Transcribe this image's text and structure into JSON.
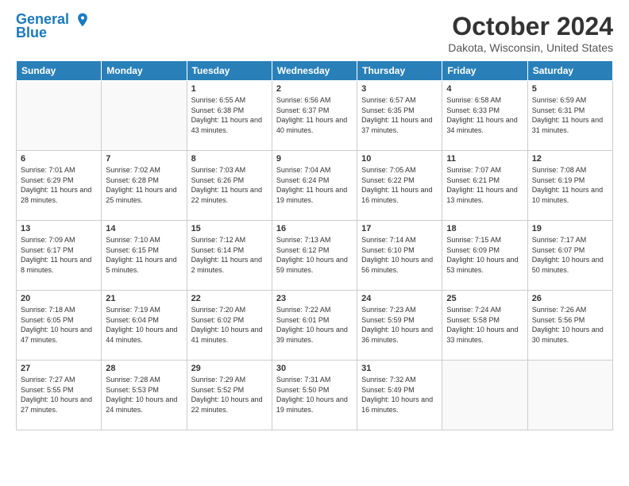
{
  "header": {
    "logo_line1": "General",
    "logo_line2": "Blue",
    "month": "October 2024",
    "location": "Dakota, Wisconsin, United States"
  },
  "days_of_week": [
    "Sunday",
    "Monday",
    "Tuesday",
    "Wednesday",
    "Thursday",
    "Friday",
    "Saturday"
  ],
  "weeks": [
    [
      {
        "day": "",
        "content": ""
      },
      {
        "day": "",
        "content": ""
      },
      {
        "day": "1",
        "content": "Sunrise: 6:55 AM\nSunset: 6:38 PM\nDaylight: 11 hours\nand 43 minutes."
      },
      {
        "day": "2",
        "content": "Sunrise: 6:56 AM\nSunset: 6:37 PM\nDaylight: 11 hours\nand 40 minutes."
      },
      {
        "day": "3",
        "content": "Sunrise: 6:57 AM\nSunset: 6:35 PM\nDaylight: 11 hours\nand 37 minutes."
      },
      {
        "day": "4",
        "content": "Sunrise: 6:58 AM\nSunset: 6:33 PM\nDaylight: 11 hours\nand 34 minutes."
      },
      {
        "day": "5",
        "content": "Sunrise: 6:59 AM\nSunset: 6:31 PM\nDaylight: 11 hours\nand 31 minutes."
      }
    ],
    [
      {
        "day": "6",
        "content": "Sunrise: 7:01 AM\nSunset: 6:29 PM\nDaylight: 11 hours\nand 28 minutes."
      },
      {
        "day": "7",
        "content": "Sunrise: 7:02 AM\nSunset: 6:28 PM\nDaylight: 11 hours\nand 25 minutes."
      },
      {
        "day": "8",
        "content": "Sunrise: 7:03 AM\nSunset: 6:26 PM\nDaylight: 11 hours\nand 22 minutes."
      },
      {
        "day": "9",
        "content": "Sunrise: 7:04 AM\nSunset: 6:24 PM\nDaylight: 11 hours\nand 19 minutes."
      },
      {
        "day": "10",
        "content": "Sunrise: 7:05 AM\nSunset: 6:22 PM\nDaylight: 11 hours\nand 16 minutes."
      },
      {
        "day": "11",
        "content": "Sunrise: 7:07 AM\nSunset: 6:21 PM\nDaylight: 11 hours\nand 13 minutes."
      },
      {
        "day": "12",
        "content": "Sunrise: 7:08 AM\nSunset: 6:19 PM\nDaylight: 11 hours\nand 10 minutes."
      }
    ],
    [
      {
        "day": "13",
        "content": "Sunrise: 7:09 AM\nSunset: 6:17 PM\nDaylight: 11 hours\nand 8 minutes."
      },
      {
        "day": "14",
        "content": "Sunrise: 7:10 AM\nSunset: 6:15 PM\nDaylight: 11 hours\nand 5 minutes."
      },
      {
        "day": "15",
        "content": "Sunrise: 7:12 AM\nSunset: 6:14 PM\nDaylight: 11 hours\nand 2 minutes."
      },
      {
        "day": "16",
        "content": "Sunrise: 7:13 AM\nSunset: 6:12 PM\nDaylight: 10 hours\nand 59 minutes."
      },
      {
        "day": "17",
        "content": "Sunrise: 7:14 AM\nSunset: 6:10 PM\nDaylight: 10 hours\nand 56 minutes."
      },
      {
        "day": "18",
        "content": "Sunrise: 7:15 AM\nSunset: 6:09 PM\nDaylight: 10 hours\nand 53 minutes."
      },
      {
        "day": "19",
        "content": "Sunrise: 7:17 AM\nSunset: 6:07 PM\nDaylight: 10 hours\nand 50 minutes."
      }
    ],
    [
      {
        "day": "20",
        "content": "Sunrise: 7:18 AM\nSunset: 6:05 PM\nDaylight: 10 hours\nand 47 minutes."
      },
      {
        "day": "21",
        "content": "Sunrise: 7:19 AM\nSunset: 6:04 PM\nDaylight: 10 hours\nand 44 minutes."
      },
      {
        "day": "22",
        "content": "Sunrise: 7:20 AM\nSunset: 6:02 PM\nDaylight: 10 hours\nand 41 minutes."
      },
      {
        "day": "23",
        "content": "Sunrise: 7:22 AM\nSunset: 6:01 PM\nDaylight: 10 hours\nand 39 minutes."
      },
      {
        "day": "24",
        "content": "Sunrise: 7:23 AM\nSunset: 5:59 PM\nDaylight: 10 hours\nand 36 minutes."
      },
      {
        "day": "25",
        "content": "Sunrise: 7:24 AM\nSunset: 5:58 PM\nDaylight: 10 hours\nand 33 minutes."
      },
      {
        "day": "26",
        "content": "Sunrise: 7:26 AM\nSunset: 5:56 PM\nDaylight: 10 hours\nand 30 minutes."
      }
    ],
    [
      {
        "day": "27",
        "content": "Sunrise: 7:27 AM\nSunset: 5:55 PM\nDaylight: 10 hours\nand 27 minutes."
      },
      {
        "day": "28",
        "content": "Sunrise: 7:28 AM\nSunset: 5:53 PM\nDaylight: 10 hours\nand 24 minutes."
      },
      {
        "day": "29",
        "content": "Sunrise: 7:29 AM\nSunset: 5:52 PM\nDaylight: 10 hours\nand 22 minutes."
      },
      {
        "day": "30",
        "content": "Sunrise: 7:31 AM\nSunset: 5:50 PM\nDaylight: 10 hours\nand 19 minutes."
      },
      {
        "day": "31",
        "content": "Sunrise: 7:32 AM\nSunset: 5:49 PM\nDaylight: 10 hours\nand 16 minutes."
      },
      {
        "day": "",
        "content": ""
      },
      {
        "day": "",
        "content": ""
      }
    ]
  ]
}
